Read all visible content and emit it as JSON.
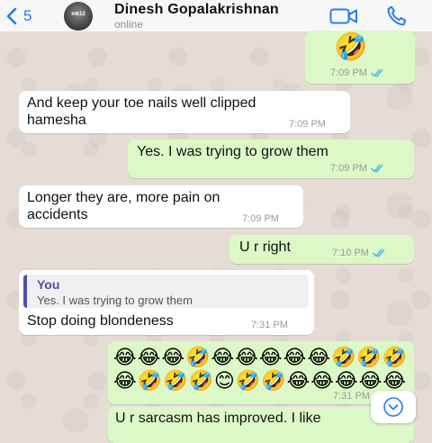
{
  "header": {
    "back_count": "5",
    "contact_name": "Dinesh Gopalakrishnan",
    "status": "online",
    "avatar_text": "mk12"
  },
  "messages": [
    {
      "direction": "outgoing",
      "text": "🤣",
      "time": "7:09 PM",
      "read": true
    },
    {
      "direction": "incoming",
      "text": "And keep your toe nails well clipped hamesha",
      "time": "7:09 PM"
    },
    {
      "direction": "outgoing",
      "text": "Yes. I was trying to grow them",
      "time": "7:09 PM",
      "read": true
    },
    {
      "direction": "incoming",
      "text": "Longer they are, more pain on accidents",
      "time": "7:09 PM"
    },
    {
      "direction": "outgoing",
      "text": "U r right",
      "time": "7:10 PM",
      "read": true
    },
    {
      "direction": "incoming",
      "quote_author": "You",
      "quote_text": "Yes. I was trying to grow them",
      "text": "Stop doing blondeness",
      "time": "7:31 PM"
    },
    {
      "direction": "outgoing",
      "text": "😂😂😂🤣😂😂😂😂😂🤣🤣🤣😂🤣🤣🤣😊🤣🤣😂😂😂😂😂",
      "time": "7:31 PM"
    },
    {
      "direction": "outgoing",
      "text": "U r sarcasm has improved. I like",
      "time": ""
    }
  ],
  "colors": {
    "accent": "#1f7cf6",
    "incoming_bubble": "#ffffff",
    "outgoing_bubble": "#dcf8c6",
    "read_ticks": "#34b7f1",
    "quote_bar": "#4e4fa4"
  },
  "icons": {
    "back": "chevron-left-icon",
    "video": "video-camera-icon",
    "call": "phone-icon",
    "read": "double-check-icon",
    "scroll": "chevron-down-icon"
  }
}
